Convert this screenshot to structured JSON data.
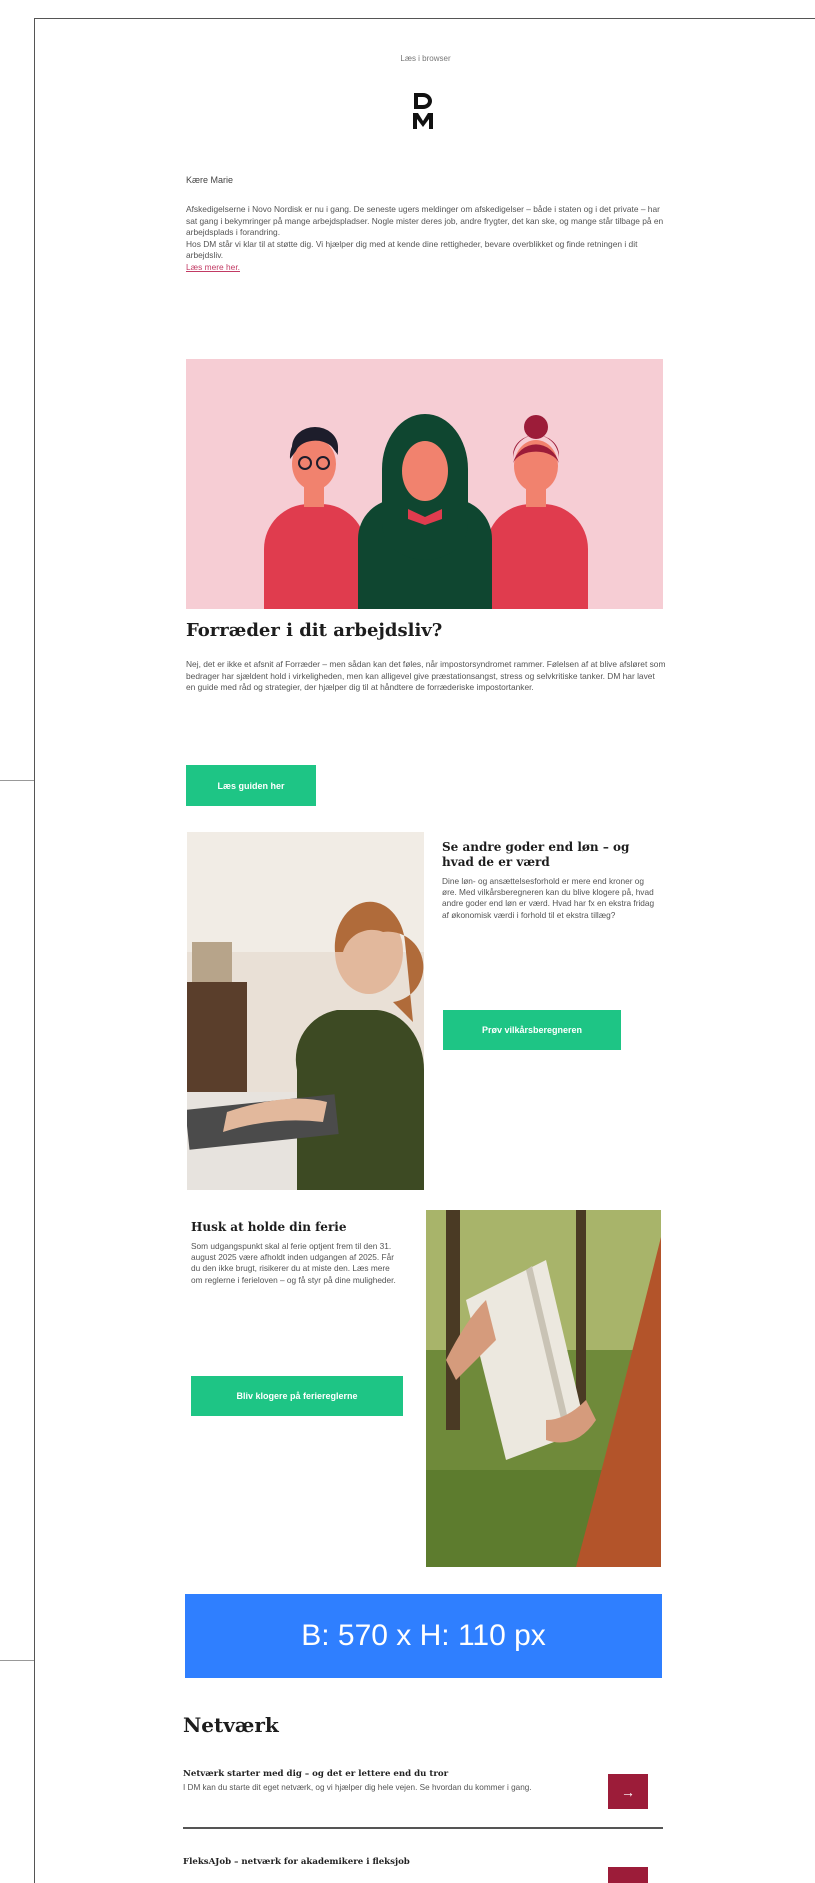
{
  "email": {
    "browser_link": "Læs i browser",
    "logo_text": "DM",
    "greeting": "Kære Marie",
    "intro_paragraph": "Afskedigelserne i Novo Nordisk er nu i gang. De seneste ugers meldinger om afskedigelser – både i staten og i det private – har sat gang i bekymringer på mange arbejdspladser. Nogle mister deres job, andre frygter, det kan ske, og mange står tilbage på en arbejdsplads i forandring.",
    "intro_paragraph_2": "Hos DM står vi klar til at støtte dig. Vi hjælper dig med at kende dine rettigheder, bevare overblikket og finde retningen i dit arbejdsliv.",
    "intro_link": "Læs mere her.",
    "articles": [
      {
        "title": "Forræder i dit arbejdsliv?",
        "body": "Nej, det er ikke et afsnit af Forræder – men sådan kan det føles, når impostorsyndromet rammer. Følelsen af at blive afsløret som bedrager har sjældent hold i virkeligheden, men kan alligevel give præstationsangst, stress og selvkritiske tanker. DM har lavet en guide med råd og strategier, der hjælper dig til at håndtere de forræderiske impostortanker.",
        "button": "Læs guiden her"
      },
      {
        "title": "Se andre goder end løn – og hvad de er værd",
        "body": "Dine løn- og ansættelsesforhold er mere end kroner og øre. Med vilkårsberegneren kan du blive klogere på, hvad andre goder end løn er værd. Hvad har fx en ekstra fridag af økonomisk værdi i forhold til et ekstra tillæg?",
        "button": "Prøv vilkårsberegneren"
      },
      {
        "title": "Husk at holde din ferie",
        "body": "Som udgangspunkt skal al ferie optjent frem til den 31. august 2025 være afholdt inden udgangen af 2025. Får du den ikke brugt, risikerer du at miste den. Læs mere om reglerne i ferieloven – og få styr på dine muligheder.",
        "button": "Bliv klogere på feriereglerne"
      }
    ],
    "dimension_banner": "B: 570 x H: 110 px",
    "network": {
      "heading": "Netværk",
      "items": [
        {
          "title": "Netværk starter med dig – og det er lettere end du tror",
          "desc": "I DM kan du starte dit eget netværk, og vi hjælper dig hele vejen. Se hvordan du kommer i gang.",
          "arrow": "→"
        },
        {
          "title": "FleksAJob – netværk for akademikere i fleksjob",
          "desc": "",
          "arrow": "→"
        }
      ]
    }
  },
  "colors": {
    "accent_green": "#1ec585",
    "hero_pink": "#f6cdd4",
    "arrow_red": "#9c1c39",
    "banner_blue": "#2f7fff"
  }
}
